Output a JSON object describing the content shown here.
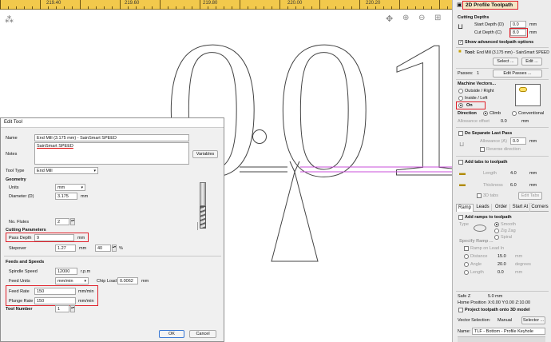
{
  "ruler": {
    "labels": [
      "219.40",
      "219.60",
      "219.80",
      "220.00",
      "220.20"
    ]
  },
  "canvas": {
    "glyphs": [
      "0",
      ".",
      "0",
      "1"
    ]
  },
  "panel": {
    "title": "2D Profile Toolpath",
    "cutting_depths": {
      "header": "Cutting Depths",
      "start_label": "Start Depth (D)",
      "start_value": "0.0",
      "cut_label": "Cut Depth (C)",
      "cut_value": "8.0",
      "unit": "mm"
    },
    "advanced_label": "Show advanced toolpath options",
    "tool": {
      "label": "Tool:",
      "value": "End Mill (3.175 mm) - SainSmart SPEED",
      "select": "Select ...",
      "edit": "Edit ..."
    },
    "passes": {
      "label": "Passes:",
      "value": "1",
      "edit": "Edit Passes ..."
    },
    "machine_vectors": {
      "header": "Machine Vectors...",
      "options": [
        "Outside / Right",
        "Inside / Left",
        "On"
      ],
      "selected": "On"
    },
    "direction": {
      "label": "Direction",
      "climb": "Climb",
      "conventional": "Conventional",
      "allowance_label": "Allowance offset",
      "allowance_value": "0.0",
      "unit": "mm"
    },
    "last_pass": {
      "header": "Do Separate Last Pass",
      "allowance_label": "Allowance (A)",
      "allowance_value": "0.0",
      "unit": "mm",
      "reverse_label": "Reverse direction"
    },
    "tabs": {
      "header": "Add tabs to toolpath",
      "length_label": "Length",
      "length_value": "4.0",
      "thickness_label": "Thickness",
      "thickness_value": "6.0",
      "unit": "mm",
      "tabs3d_label": "3D tabs",
      "edit_tabs": "Edit Tabs ..."
    },
    "subtabs": [
      "Ramp",
      "Leads",
      "Order",
      "Start At",
      "Corners"
    ],
    "ramps": {
      "header": "Add ramps to toolpath",
      "type_label": "Type",
      "types": [
        "Smooth",
        "Zig Zag",
        "Spiral"
      ],
      "specify_label": "Specify Ramp ...",
      "ramp_lead": "Ramp on Lead In",
      "distance_label": "Distance",
      "distance_value": "15.0",
      "distance_unit": "mm",
      "angle_label": "Angle",
      "angle_value": "20.0",
      "angle_unit": "degrees",
      "length_label": "Length",
      "length_value": "0.0",
      "length_unit": "mm"
    },
    "safe_z": {
      "label": "Safe Z",
      "value": "5.0 mm"
    },
    "home_position": {
      "label": "Home Position",
      "value": "X:0.00 Y:0.00 Z:10.00"
    },
    "project_label": "Project toolpath onto 3D model",
    "vector_selection": {
      "label": "Vector Selection:",
      "value": "Manual",
      "selector": "Selector ..."
    },
    "name": {
      "label": "Name:",
      "value": "TLF - Bottom - Profile Keyhole"
    },
    "colors": {
      "accent_red": "#e0202a",
      "ruler": "#f2c94c"
    }
  },
  "dialog": {
    "title": "Edit Tool",
    "name_label": "Name",
    "name_value": "End Mill (3.175 mm) - SainSmart SPEED",
    "notes_label": "Notes",
    "notes_value": "SainSmart SPEED",
    "variables": "Variables",
    "tool_type_label": "Tool Type",
    "tool_type_value": "End Mill",
    "geometry": {
      "header": "Geometry",
      "units_label": "Units",
      "units_value": "mm",
      "diameter_label": "Diameter (D)",
      "diameter_value": "3.175",
      "diameter_unit": "mm",
      "flutes_label": "No. Flutes",
      "flutes_value": "2"
    },
    "cutting": {
      "header": "Cutting Parameters",
      "pass_depth_label": "Pass Depth",
      "pass_depth_value": "9",
      "pass_depth_unit": "mm",
      "stepover_label": "Stepover",
      "stepover_value": "1.27",
      "stepover_unit": "mm",
      "stepover_pct": "40",
      "pct_sign": "%"
    },
    "feeds": {
      "header": "Feeds and Speeds",
      "spindle_label": "Spindle Speed",
      "spindle_value": "12000",
      "spindle_unit": "r.p.m",
      "feed_units_label": "Feed Units",
      "feed_units_value": "mm/min",
      "chip_load_label": "Chip Load",
      "chip_load_value": "0.0062",
      "chip_load_unit": "mm",
      "feed_rate_label": "Feed Rate",
      "feed_rate_value": "150",
      "plunge_rate_label": "Plunge Rate",
      "plunge_rate_value": "150",
      "rate_unit": "mm/min"
    },
    "tool_number_label": "Tool Number",
    "tool_number_value": "1",
    "ok": "OK",
    "cancel": "Cancel"
  }
}
